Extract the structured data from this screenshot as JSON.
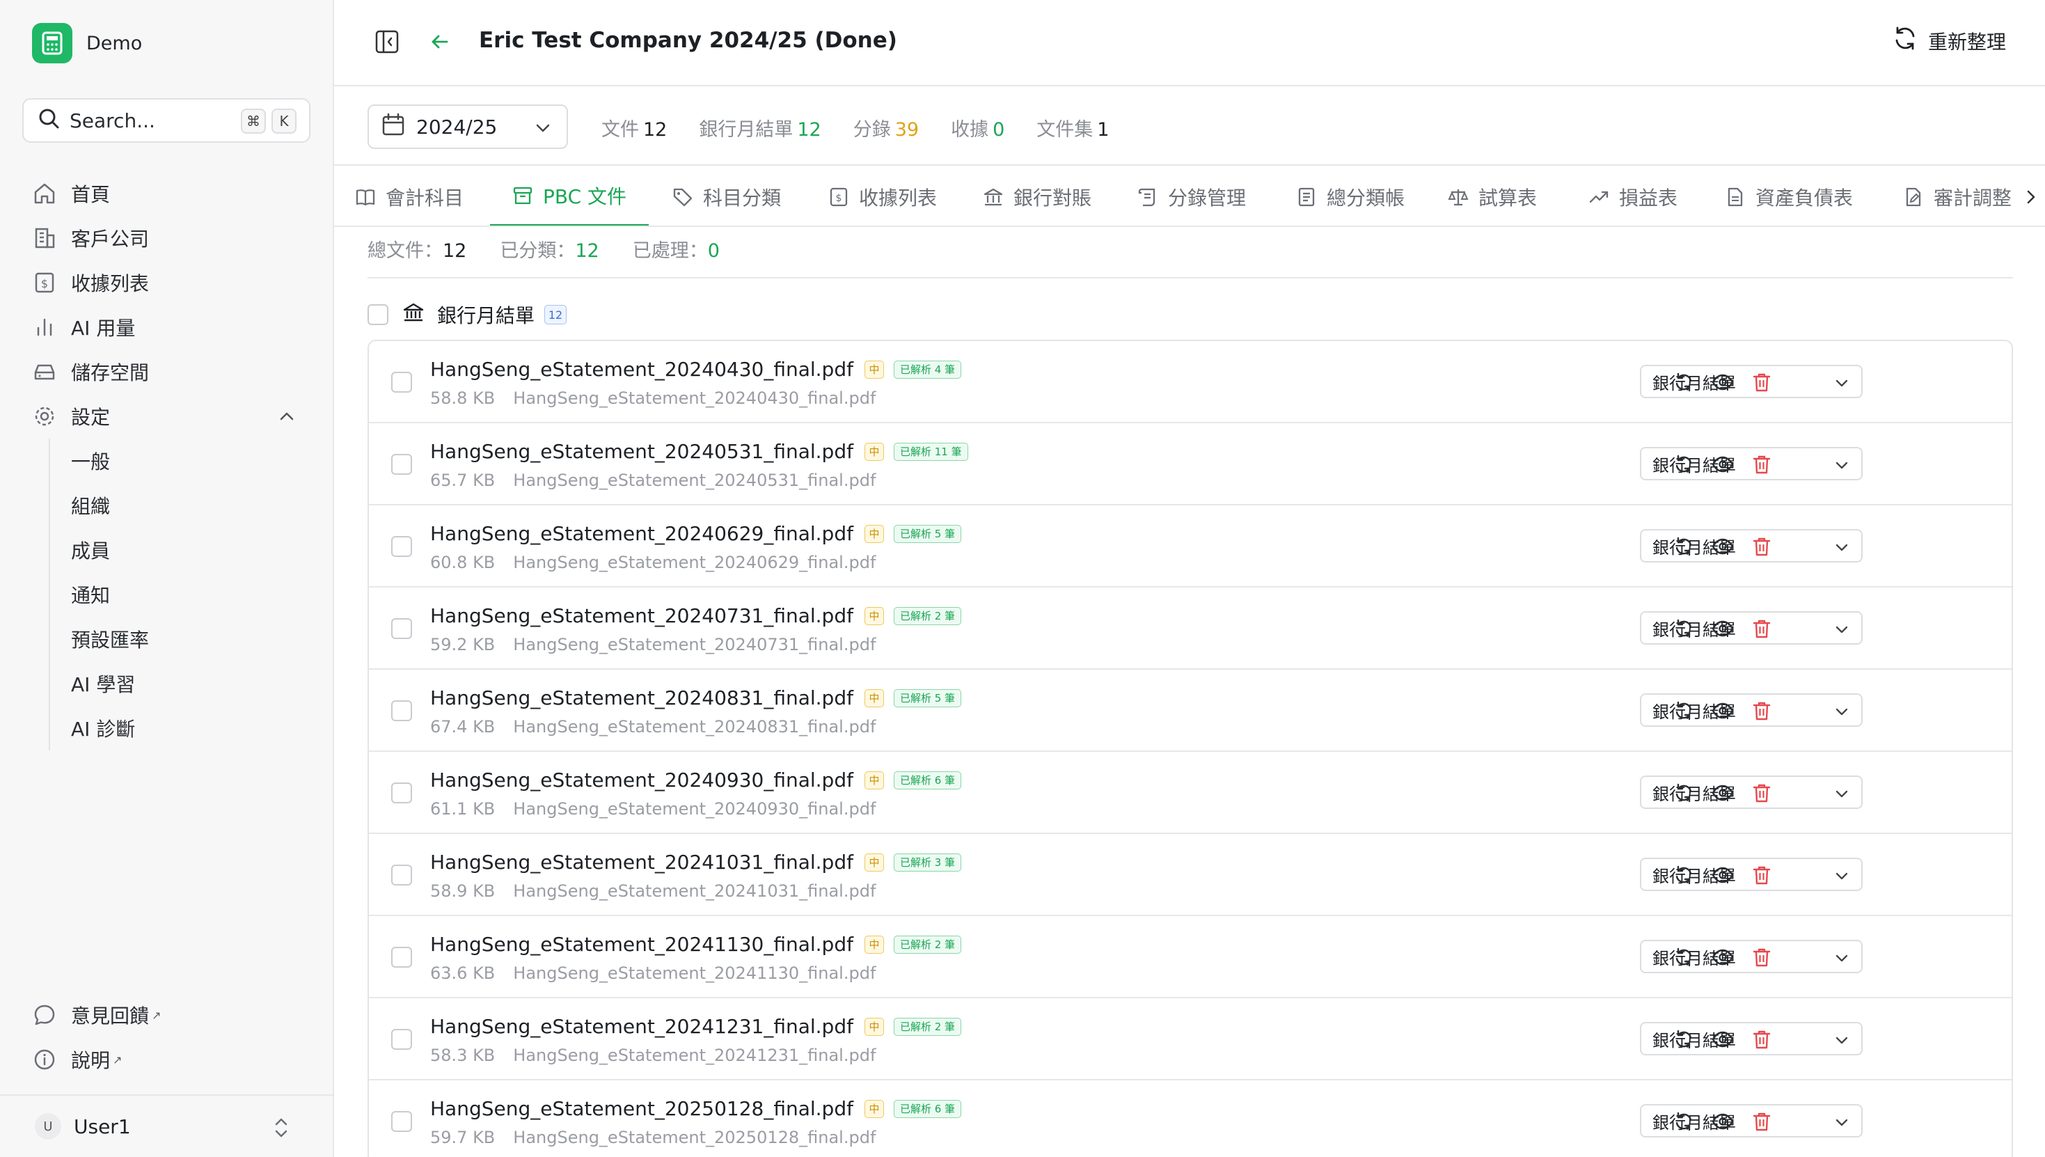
{
  "brand": {
    "name": "Demo"
  },
  "search": {
    "label": "Search...",
    "kbd_cmd": "⌘",
    "kbd_key": "K"
  },
  "sidebar": {
    "items": [
      {
        "label": "首頁",
        "icon": "home-icon"
      },
      {
        "label": "客戶公司",
        "icon": "building-icon"
      },
      {
        "label": "收據列表",
        "icon": "receipt-icon"
      },
      {
        "label": "AI 用量",
        "icon": "bar-chart-icon"
      },
      {
        "label": "儲存空間",
        "icon": "hard-drive-icon"
      },
      {
        "label": "設定",
        "icon": "gear-icon"
      }
    ],
    "settings_sub": [
      "一般",
      "組織",
      "成員",
      "通知",
      "預設匯率",
      "AI 學習",
      "AI 診斷"
    ],
    "bottom": [
      {
        "label": "意見回饋",
        "icon": "message-icon"
      },
      {
        "label": "說明",
        "icon": "info-icon"
      }
    ],
    "user": {
      "initial": "U",
      "name": "User1"
    }
  },
  "header": {
    "title": "Eric Test Company 2024/25 (Done)",
    "refresh_label": "重新整理"
  },
  "stats": {
    "period": "2024/25",
    "items": [
      {
        "label": "文件",
        "value": "12",
        "color": "dark"
      },
      {
        "label": "銀行月結單",
        "value": "12",
        "color": "green"
      },
      {
        "label": "分錄",
        "value": "39",
        "color": "amber"
      },
      {
        "label": "收據",
        "value": "0",
        "color": "green"
      },
      {
        "label": "文件集",
        "value": "1",
        "color": "dark"
      }
    ]
  },
  "tabs": [
    {
      "label": "會計科目",
      "icon": "book-icon"
    },
    {
      "label": "PBC 文件",
      "icon": "archive-icon",
      "active": true
    },
    {
      "label": "科目分類",
      "icon": "tag-icon"
    },
    {
      "label": "收據列表",
      "icon": "receipt-icon"
    },
    {
      "label": "銀行對賬",
      "icon": "bank-icon"
    },
    {
      "label": "分錄管理",
      "icon": "scroll-icon"
    },
    {
      "label": "總分類帳",
      "icon": "ledger-icon"
    },
    {
      "label": "試算表",
      "icon": "scale-icon"
    },
    {
      "label": "損益表",
      "icon": "trending-up-icon"
    },
    {
      "label": "資產負債表",
      "icon": "file-sheet-icon"
    },
    {
      "label": "審計調整",
      "icon": "file-edit-icon"
    }
  ],
  "summary": {
    "total_label": "總文件：",
    "total": "12",
    "classified_label": "已分類：",
    "classified": "12",
    "processed_label": "已處理：",
    "processed": "0"
  },
  "group": {
    "title": "銀行月結單",
    "count": "12"
  },
  "files": [
    {
      "name": "HangSeng_eStatement_20240430_final.pdf",
      "mid": "中",
      "parsed": "已解析 4 筆",
      "size": "58.8 KB",
      "path": "HangSeng_eStatement_20240430_final.pdf",
      "category": "銀行月結單"
    },
    {
      "name": "HangSeng_eStatement_20240531_final.pdf",
      "mid": "中",
      "parsed": "已解析 11 筆",
      "size": "65.7 KB",
      "path": "HangSeng_eStatement_20240531_final.pdf",
      "category": "銀行月結單"
    },
    {
      "name": "HangSeng_eStatement_20240629_final.pdf",
      "mid": "中",
      "parsed": "已解析 5 筆",
      "size": "60.8 KB",
      "path": "HangSeng_eStatement_20240629_final.pdf",
      "category": "銀行月結單"
    },
    {
      "name": "HangSeng_eStatement_20240731_final.pdf",
      "mid": "中",
      "parsed": "已解析 2 筆",
      "size": "59.2 KB",
      "path": "HangSeng_eStatement_20240731_final.pdf",
      "category": "銀行月結單"
    },
    {
      "name": "HangSeng_eStatement_20240831_final.pdf",
      "mid": "中",
      "parsed": "已解析 5 筆",
      "size": "67.4 KB",
      "path": "HangSeng_eStatement_20240831_final.pdf",
      "category": "銀行月結單"
    },
    {
      "name": "HangSeng_eStatement_20240930_final.pdf",
      "mid": "中",
      "parsed": "已解析 6 筆",
      "size": "61.1 KB",
      "path": "HangSeng_eStatement_20240930_final.pdf",
      "category": "銀行月結單"
    },
    {
      "name": "HangSeng_eStatement_20241031_final.pdf",
      "mid": "中",
      "parsed": "已解析 3 筆",
      "size": "58.9 KB",
      "path": "HangSeng_eStatement_20241031_final.pdf",
      "category": "銀行月結單"
    },
    {
      "name": "HangSeng_eStatement_20241130_final.pdf",
      "mid": "中",
      "parsed": "已解析 2 筆",
      "size": "63.6 KB",
      "path": "HangSeng_eStatement_20241130_final.pdf",
      "category": "銀行月結單"
    },
    {
      "name": "HangSeng_eStatement_20241231_final.pdf",
      "mid": "中",
      "parsed": "已解析 2 筆",
      "size": "58.3 KB",
      "path": "HangSeng_eStatement_20241231_final.pdf",
      "category": "銀行月結單"
    },
    {
      "name": "HangSeng_eStatement_20250128_final.pdf",
      "mid": "中",
      "parsed": "已解析 6 筆",
      "size": "59.7 KB",
      "path": "HangSeng_eStatement_20250128_final.pdf",
      "category": "銀行月結單"
    }
  ],
  "colors": {
    "accent": "#1aa655",
    "amber": "#e0a317",
    "danger": "#e5484d",
    "brand": "#1fb866"
  }
}
